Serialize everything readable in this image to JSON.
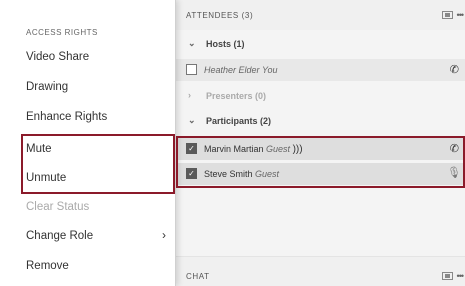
{
  "attendees": {
    "title": "ATTENDEES (3)",
    "groups": {
      "hosts": "Hosts (1)",
      "presenters": "Presenters (0)",
      "participants": "Participants (2)"
    },
    "hosts": [
      {
        "name": "Heather Elder",
        "role": "You"
      }
    ],
    "participants": [
      {
        "name": "Marvin Martian",
        "role": "Guest"
      },
      {
        "name": "Steve Smith",
        "role": "Guest"
      }
    ]
  },
  "chat": {
    "title": "CHAT"
  },
  "menu": {
    "title": "ACCESS RIGHTS",
    "items": [
      {
        "label": "Video Share"
      },
      {
        "label": "Drawing"
      },
      {
        "label": "Enhance Rights"
      },
      {
        "label": "Mute"
      },
      {
        "label": "Unmute"
      },
      {
        "label": "Clear Status"
      },
      {
        "label": "Change Role"
      },
      {
        "label": "Remove"
      }
    ]
  },
  "icons": {
    "chevron_down": "chevron-down-icon",
    "chevron_right": "chevron-right-icon",
    "phone": "phone-icon",
    "speaker": "speaker-icon",
    "mic_muted": "mic-muted-icon",
    "fullscreen": "fullscreen-icon",
    "more": "more-icon"
  },
  "colors": {
    "highlight": "#8b1a2a"
  }
}
